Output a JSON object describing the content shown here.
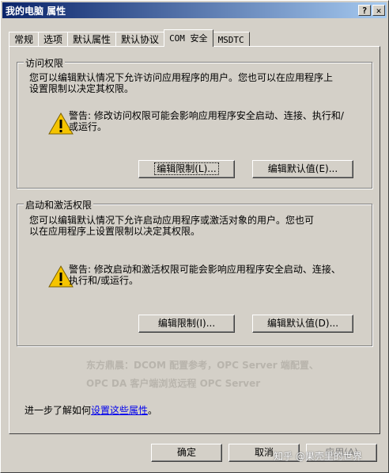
{
  "window": {
    "title": "我的电脑 属性",
    "help_btn": "?",
    "close_btn": "✕"
  },
  "tabs": [
    "常规",
    "选项",
    "默认属性",
    "默认协议",
    "COM 安全",
    "MSDTC"
  ],
  "access": {
    "legend": "访问权限",
    "desc": "您可以编辑默认情况下允许访问应用程序的用户。您也可以在应用程序上设置限制以决定其权限。",
    "warning": "警告: 修改访问权限可能会影响应用程序安全启动、连接、执行和/或运行。",
    "edit_limits": "编辑限制(L)...",
    "edit_default": "编辑默认值(E)..."
  },
  "launch": {
    "legend": "启动和激活权限",
    "desc": "您可以编辑默认情况下允许启动应用程序或激活对象的用户。您也可以在应用程序上设置限制以决定其权限。",
    "warning": "警告: 修改启动和激活权限可能会影响应用程序安全启动、连接、执行和/或运行。",
    "edit_limits": "编辑限制(I)...",
    "edit_default": "编辑默认值(D)..."
  },
  "watermark": {
    "line1": "东方鼎晨：DCOM 配置参考，OPC Server 端配置、",
    "line2": "OPC DA 客户端浏览远程 OPC Server"
  },
  "learn": {
    "prefix": "进一步了解如何",
    "link": "设置这些属性",
    "suffix": "。"
  },
  "buttons": {
    "ok": "确定",
    "cancel": "取消",
    "apply": "应用(A)"
  },
  "overlay": "知乎 @果壳里的世界",
  "colors": {
    "titlebar_start": "#0a246a",
    "titlebar_end": "#a6caf0",
    "face": "#d4d0c8",
    "link": "#0000ee",
    "warning": "#f5c400"
  }
}
